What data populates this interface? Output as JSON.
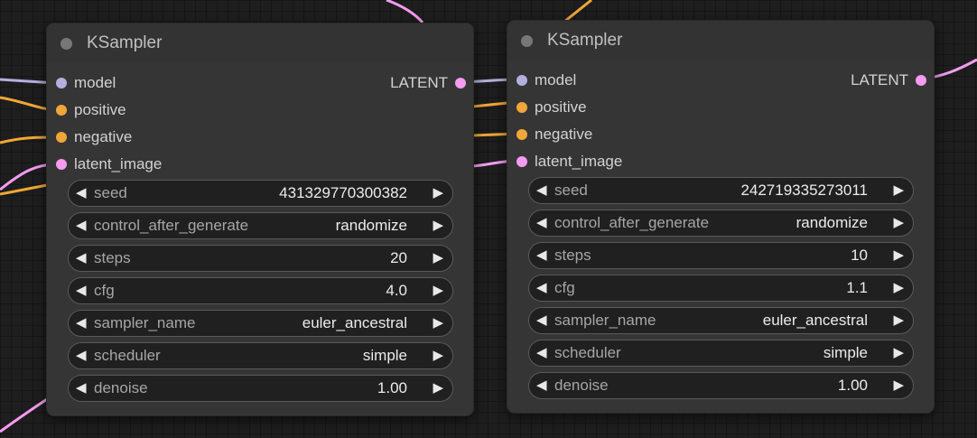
{
  "colors": {
    "model": "#b3b0df",
    "positive": "#f0a738",
    "negative": "#f0a738",
    "latent_image": "#f39cf0",
    "latent_out": "#f39cf0"
  },
  "nodes": [
    {
      "title": "KSampler",
      "inputs": [
        "model",
        "positive",
        "negative",
        "latent_image"
      ],
      "output": "LATENT",
      "widgets": [
        {
          "label": "seed",
          "value": "431329770300382"
        },
        {
          "label": "control_after_generate",
          "value": "randomize"
        },
        {
          "label": "steps",
          "value": "20"
        },
        {
          "label": "cfg",
          "value": "4.0"
        },
        {
          "label": "sampler_name",
          "value": "euler_ancestral"
        },
        {
          "label": "scheduler",
          "value": "simple"
        },
        {
          "label": "denoise",
          "value": "1.00"
        }
      ]
    },
    {
      "title": "KSampler",
      "inputs": [
        "model",
        "positive",
        "negative",
        "latent_image"
      ],
      "output": "LATENT",
      "widgets": [
        {
          "label": "seed",
          "value": "242719335273011"
        },
        {
          "label": "control_after_generate",
          "value": "randomize"
        },
        {
          "label": "steps",
          "value": "10"
        },
        {
          "label": "cfg",
          "value": "1.1"
        },
        {
          "label": "sampler_name",
          "value": "euler_ancestral"
        },
        {
          "label": "scheduler",
          "value": "simple"
        },
        {
          "label": "denoise",
          "value": "1.00"
        }
      ]
    }
  ]
}
